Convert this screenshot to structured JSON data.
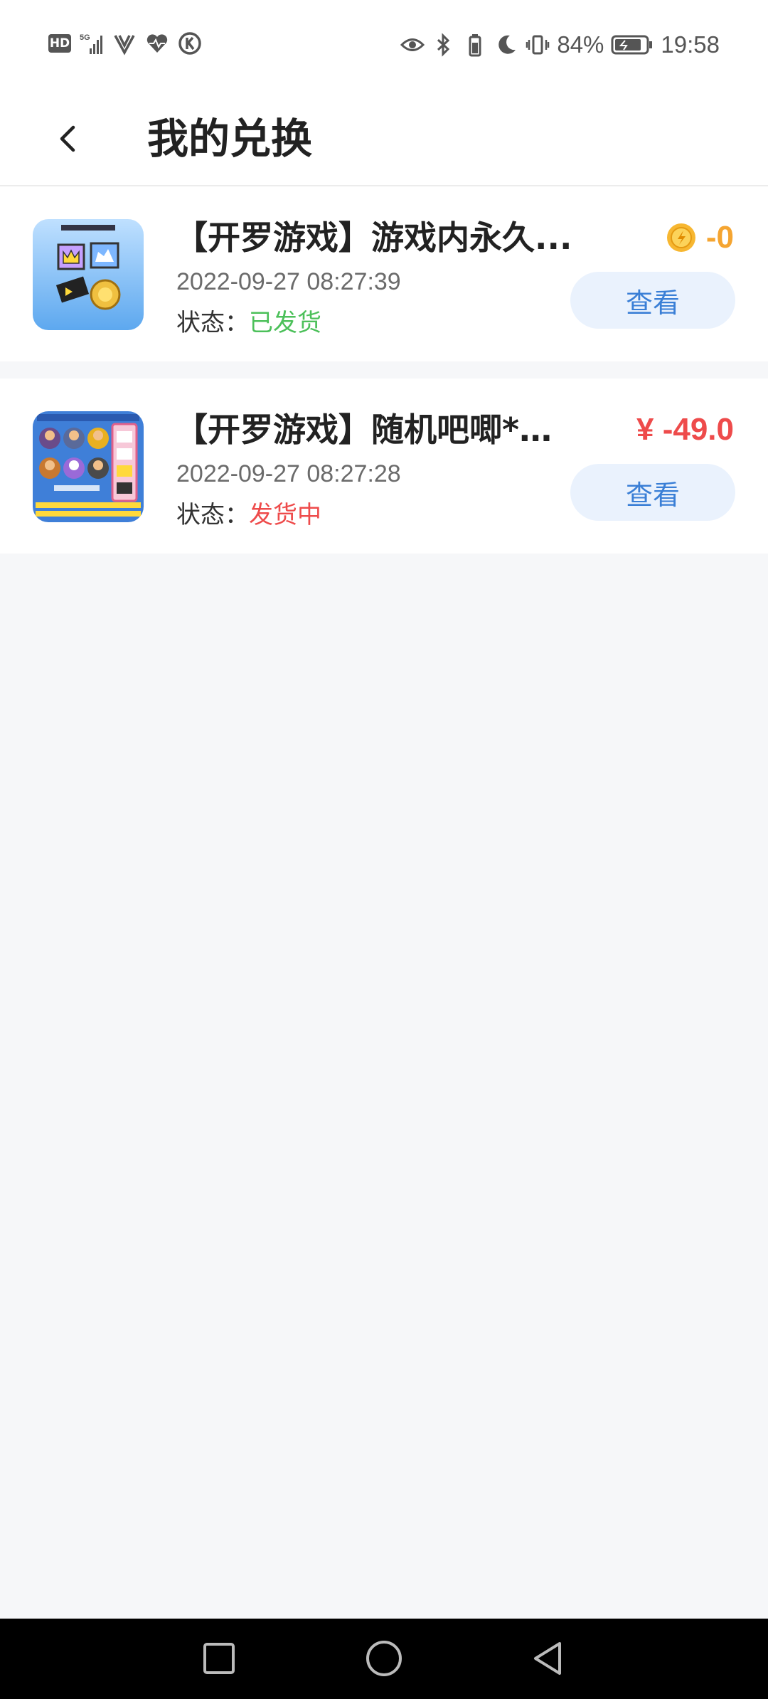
{
  "status_bar": {
    "hd": "HD",
    "battery_percent": "84%",
    "time": "19:58"
  },
  "header": {
    "title": "我的兑换"
  },
  "orders": [
    {
      "title": "【开罗游戏】游戏内永久...",
      "time": "2022-09-27  08:27:39",
      "status_label": "状态：",
      "status_value": "已发货",
      "price": "-0",
      "price_currency": "coin-icon",
      "button_label": "查看"
    },
    {
      "title": "【开罗游戏】随机吧唧*2...",
      "time": "2022-09-27  08:27:28",
      "status_label": "状态：",
      "status_value": "发货中",
      "price": "¥ -49.0",
      "price_currency": "yuan",
      "button_label": "查看"
    }
  ],
  "colors": {
    "accent_blue": "#3a7fd6",
    "status_green": "#4cc05a",
    "status_red": "#ee4b4b",
    "coin_orange": "#f5a531"
  }
}
